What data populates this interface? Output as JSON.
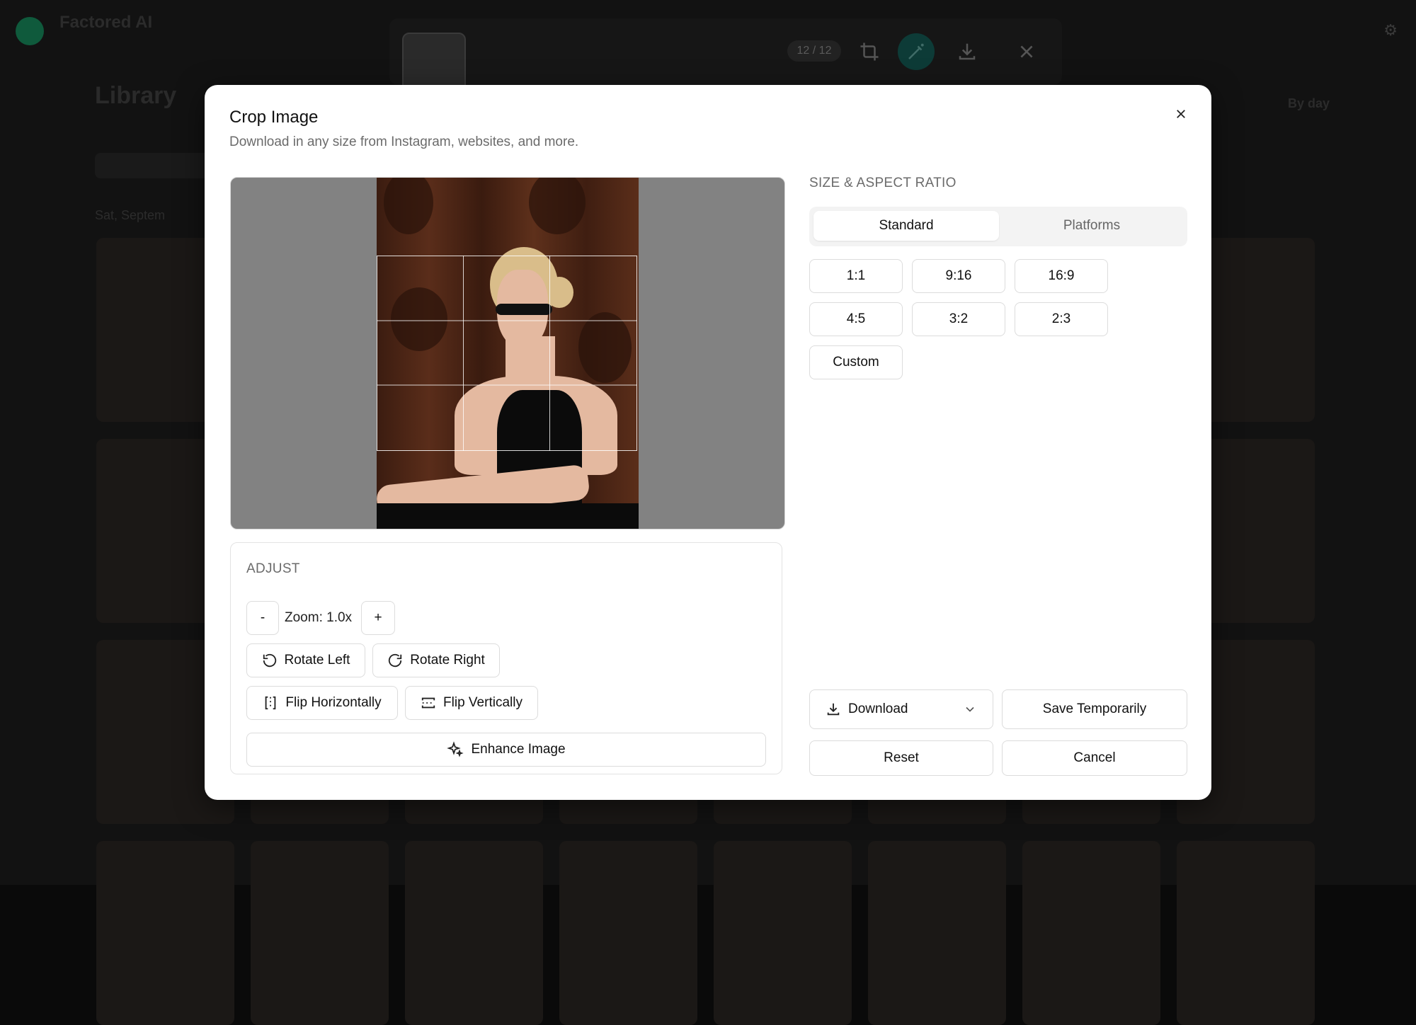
{
  "background": {
    "brand": "Factored AI",
    "brand_sub": "",
    "library_title": "Library",
    "library_sub": "",
    "date_group": "Sat, Septem",
    "view_toggle": "By day"
  },
  "viewer": {
    "counter": "12 / 12",
    "accent_color": "#0d3b37"
  },
  "modal": {
    "title": "Crop Image",
    "subtitle": "Download in any size from Instagram, websites, and more.",
    "adjust": {
      "section_label": "ADJUST",
      "zoom_minus": "-",
      "zoom_label": "Zoom: 1.0x",
      "zoom_plus": "+",
      "rotate_left": "Rotate Left",
      "rotate_right": "Rotate Right",
      "flip_horizontal": "Flip Horizontally",
      "flip_vertical": "Flip Vertically",
      "enhance": "Enhance Image"
    },
    "size": {
      "section_label": "SIZE & ASPECT RATIO",
      "tabs": [
        "Standard",
        "Platforms"
      ],
      "active_tab": "Standard",
      "ratios": [
        "1:1",
        "9:16",
        "16:9",
        "4:5",
        "3:2",
        "2:3",
        "Custom"
      ]
    },
    "actions": {
      "download": "Download",
      "save_temporarily": "Save Temporarily",
      "reset": "Reset",
      "cancel": "Cancel"
    }
  }
}
